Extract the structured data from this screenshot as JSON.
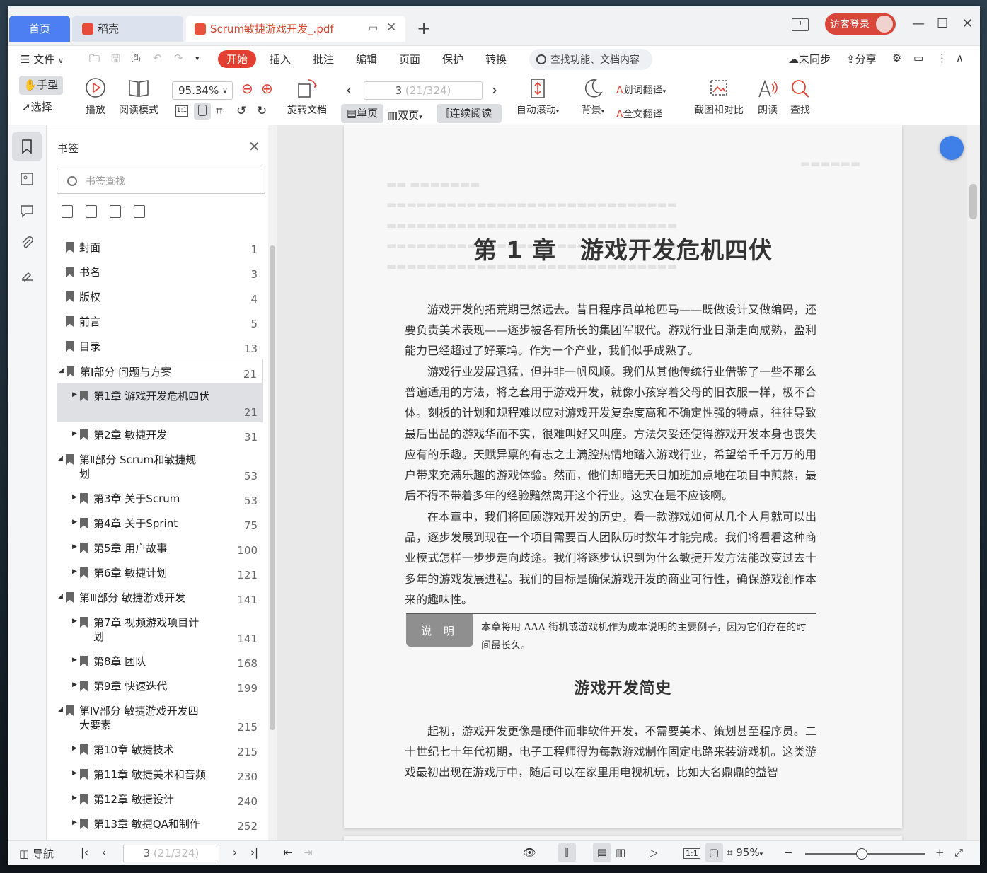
{
  "tabs": {
    "home": "首页",
    "daoke": "稻壳",
    "doc": "Scrum敏捷游戏开发_.pdf",
    "sidebar_num": "1"
  },
  "login": "访客登录",
  "menu": {
    "file": "文件",
    "items": [
      "开始",
      "插入",
      "批注",
      "编辑",
      "页面",
      "保护",
      "转换"
    ],
    "search": "查找功能、文档内容",
    "sync": "未同步",
    "share": "分享"
  },
  "toolbar": {
    "hand": "手型",
    "select": "选择",
    "play": "播放",
    "read_mode": "阅读模式",
    "zoom": "95.34%",
    "rotate": "旋转文档",
    "page_current": "3",
    "page_total": "(21/324)",
    "single": "单页",
    "double": "双页",
    "continuous": "连续阅读",
    "autoscroll": "自动滚动",
    "background": "背景",
    "word_translate": "划词翻译",
    "full_translate": "全文翻译",
    "screenshot": "截图和对比",
    "read_aloud": "朗读",
    "find": "查找",
    "one_to_one": "1:1"
  },
  "bookmark": {
    "title": "书签",
    "search_placeholder": "书签查找",
    "items": [
      {
        "label": "封面",
        "page": "1"
      },
      {
        "label": "书名",
        "page": "3"
      },
      {
        "label": "版权",
        "page": "4"
      },
      {
        "label": "前言",
        "page": "5"
      },
      {
        "label": "目录",
        "page": "13"
      },
      {
        "label": "第Ⅰ部分 问题与方案",
        "page": "21"
      },
      {
        "label": "第1章 游戏开发危机四伏",
        "page": "21"
      },
      {
        "label": "第2章 敏捷开发",
        "page": "31"
      },
      {
        "label": "第Ⅱ部分 Scrum和敏捷规划",
        "page": "53"
      },
      {
        "label": "第3章 关于Scrum",
        "page": "53"
      },
      {
        "label": "第4章 关于Sprint",
        "page": "75"
      },
      {
        "label": "第5章 用户故事",
        "page": "100"
      },
      {
        "label": "第6章 敏捷计划",
        "page": "121"
      },
      {
        "label": "第Ⅲ部分 敏捷游戏开发",
        "page": "141"
      },
      {
        "label": "第7章 视频游戏项目计划",
        "page": "141"
      },
      {
        "label": "第8章 团队",
        "page": "168"
      },
      {
        "label": "第9章 快速迭代",
        "page": "199"
      },
      {
        "label": "第Ⅳ部分 敏捷游戏开发四大要素",
        "page": "215"
      },
      {
        "label": "第10章 敏捷技术",
        "page": "215"
      },
      {
        "label": "第11章 敏捷美术和音频",
        "page": "230"
      },
      {
        "label": "第12章 敏捷设计",
        "page": "240"
      },
      {
        "label": "第13章 敏捷QA和制作",
        "page": "252"
      }
    ]
  },
  "page": {
    "chapter_title": "第 1 章　游戏开发危机四伏",
    "p1": "游戏开发的拓荒期已然远去。昔日程序员单枪匹马——既做设计又做编码，还要负责美术表现——逐步被各有所长的集团军取代。游戏行业日渐走向成熟，盈利能力已经超过了好莱坞。作为一个产业，我们似乎成熟了。",
    "p2": "游戏行业发展迅猛，但并非一帆风顺。我们从其他传统行业借鉴了一些不那么普遍适用的方法，将之套用于游戏开发，就像小孩穿着父母的旧衣服一样，极不合体。刻板的计划和规程难以应对游戏开发复杂度高和不确定性强的特点，往往导致最后出品的游戏华而不实，很难叫好又叫座。方法欠妥还使得游戏开发本身也丧失应有的乐趣。天赋异禀的有志之士满腔热情地踏入游戏行业，希望给千千万万的用户带来充满乐趣的游戏体验。然而，他们却暗无天日加班加点地在项目中煎熬，最后不得不带着多年的经验黯然离开这个行业。这实在是不应该啊。",
    "p3": "在本章中，我们将回顾游戏开发的历史，看一款游戏如何从几个人月就可以出品，逐步发展到现在一个项目需要百人团队历时数年才能完成。我们将看看这种商业模式怎样一步步走向歧途。我们将逐步认识到为什么敏捷开发方法能改变过去十多年的游戏发展进程。我们的目标是确保游戏开发的商业可行性，确保游戏创作本来的趣味性。",
    "note_badge": "说 明",
    "note_text": "本章将用 AAA 街机或游戏机作为成本说明的主要例子，因为它们存在的时间最长久。",
    "section_title": "游戏开发简史",
    "p4": "起初，游戏开发更像是硬件而非软件开发，不需要美术、策划甚至程序员。二十世纪七十年代初期，电子工程师得为每款游戏制作固定电路来装游戏机。这类游戏最初出现在游戏厅中，随后可以在家里用电视机玩，比如大名鼎鼎的益智"
  },
  "status": {
    "nav": "导航",
    "page_current": "3",
    "page_total": "(21/324)",
    "zoom": "95%",
    "one_to_one": "1:1"
  },
  "colors": {
    "accent": "#e23e32",
    "home_tab": "#4e7ff2"
  }
}
